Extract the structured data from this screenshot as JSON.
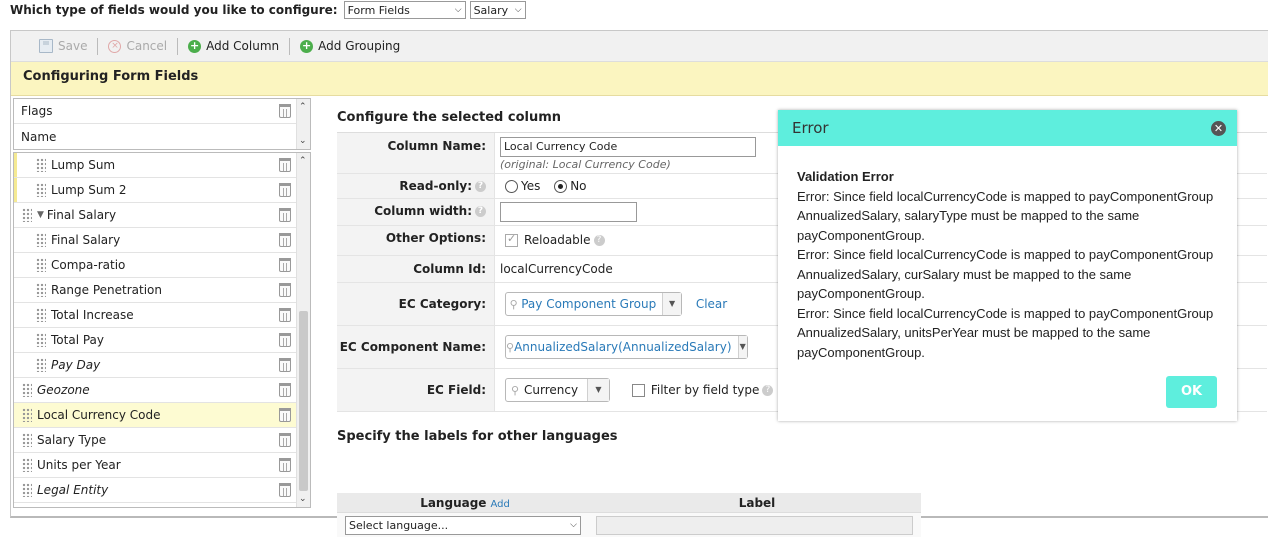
{
  "top": {
    "question": "Which type of fields would you like to configure:",
    "field_type_select": "Form Fields",
    "field_subtype_select": "Salary"
  },
  "toolbar": {
    "save": "Save",
    "cancel": "Cancel",
    "add_column": "Add Column",
    "add_grouping": "Add Grouping"
  },
  "band": {
    "title": "Configuring Form Fields"
  },
  "left_top": {
    "flags": "Flags",
    "name": "Name"
  },
  "left_list": [
    {
      "label": "Lump Sum",
      "indent": true
    },
    {
      "label": "Lump Sum 2",
      "indent": true
    },
    {
      "label": "Final Salary",
      "group": true
    },
    {
      "label": "Final Salary",
      "indent": true
    },
    {
      "label": "Compa-ratio",
      "indent": true
    },
    {
      "label": "Range Penetration",
      "indent": true
    },
    {
      "label": "Total Increase",
      "indent": true
    },
    {
      "label": "Total Pay",
      "indent": true
    },
    {
      "label": "Pay Day",
      "indent": true,
      "italic": true
    },
    {
      "label": "Geozone",
      "italic": true
    },
    {
      "label": "Local Currency Code",
      "selected": true
    },
    {
      "label": "Salary Type"
    },
    {
      "label": "Units per Year"
    },
    {
      "label": "Legal Entity",
      "italic": true
    }
  ],
  "config": {
    "title": "Configure the selected column",
    "column_name_label": "Column Name:",
    "column_name_value": "Local Currency Code",
    "column_name_original": "(original: Local Currency Code)",
    "readonly_label": "Read-only:",
    "readonly_yes": "Yes",
    "readonly_no": "No",
    "width_label": "Column width:",
    "width_value": "",
    "other_label": "Other Options:",
    "reloadable": "Reloadable",
    "colid_label": "Column Id:",
    "colid_value": "localCurrencyCode",
    "ec_category_label": "EC Category:",
    "ec_category_value": "Pay Component Group",
    "clear": "Clear",
    "ec_component_label": "EC Component Name:",
    "ec_component_value": "AnnualizedSalary(AnnualizedSalary)",
    "ec_field_label": "EC Field:",
    "ec_field_value": "Currency",
    "filter_by_type": "Filter by field type"
  },
  "languages": {
    "title": "Specify the labels for other languages",
    "col_language": "Language",
    "add": "Add",
    "col_label": "Label",
    "select_placeholder": "Select language..."
  },
  "modal": {
    "title": "Error",
    "heading": "Validation Error",
    "line1": "Error: Since field localCurrencyCode is mapped to payComponentGroup",
    "line2": "AnnualizedSalary, salaryType must be mapped to the same",
    "line3": "payComponentGroup.",
    "line4": "Error: Since field localCurrencyCode is mapped to payComponentGroup",
    "line5": "AnnualizedSalary, curSalary must be mapped to the same",
    "line6": "payComponentGroup.",
    "line7": "Error: Since field localCurrencyCode is mapped to payComponentGroup",
    "line8": "AnnualizedSalary, unitsPerYear must be mapped to the same",
    "line9": "payComponentGroup.",
    "ok": "OK"
  },
  "colors": {
    "accent": "#5eeedd",
    "band": "#fbf5c0",
    "link": "#2a7ab8"
  },
  "icons": [
    "save-icon",
    "cancel-icon",
    "add-icon",
    "trash-icon",
    "grip-icon",
    "help-icon",
    "close-icon",
    "search-icon",
    "chevron-down-icon"
  ]
}
